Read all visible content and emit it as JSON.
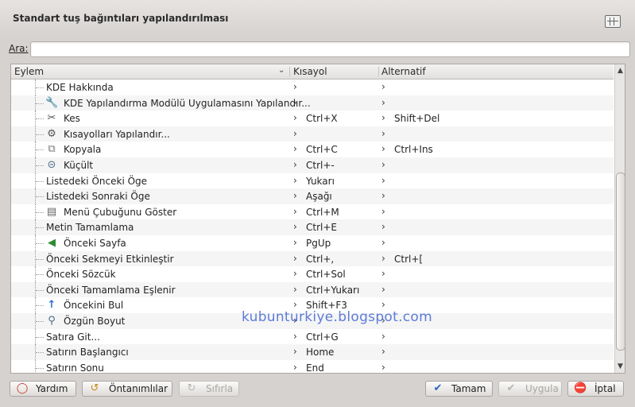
{
  "window": {
    "title": "Standart tuş bağıntıları yapılandırılması",
    "title_icon": "keyboard-grid-icon"
  },
  "search": {
    "label": "Ara:",
    "value": "",
    "placeholder": ""
  },
  "tree": {
    "columns": [
      "Eylem",
      "Kısayol",
      "Alternatif"
    ],
    "rows": [
      {
        "name": "KDE Hakkında",
        "icon": "",
        "shortcut": "",
        "alternate": ""
      },
      {
        "name": "KDE Yapılandırma Modülü Uygulamasını Yapılandır...",
        "icon": "wrench-icon",
        "shortcut": "",
        "alternate": ""
      },
      {
        "name": "Kes",
        "icon": "scissors-icon",
        "shortcut": "Ctrl+X",
        "alternate": "Shift+Del"
      },
      {
        "name": "Kısayolları Yapılandır...",
        "icon": "configure-shortcuts-icon",
        "shortcut": "",
        "alternate": ""
      },
      {
        "name": "Kopyala",
        "icon": "copy-icon",
        "shortcut": "Ctrl+C",
        "alternate": "Ctrl+Ins"
      },
      {
        "name": "Küçült",
        "icon": "zoom-out-icon",
        "shortcut": "Ctrl+-",
        "alternate": ""
      },
      {
        "name": "Listedeki Önceki Öge",
        "icon": "",
        "shortcut": "Yukarı",
        "alternate": ""
      },
      {
        "name": "Listedeki Sonraki Öge",
        "icon": "",
        "shortcut": "Aşağı",
        "alternate": ""
      },
      {
        "name": "Menü Çubuğunu Göster",
        "icon": "menubar-icon",
        "shortcut": "Ctrl+M",
        "alternate": ""
      },
      {
        "name": "Metin Tamamlama",
        "icon": "",
        "shortcut": "Ctrl+E",
        "alternate": ""
      },
      {
        "name": "Önceki Sayfa",
        "icon": "previous-page-icon",
        "shortcut": "PgUp",
        "alternate": ""
      },
      {
        "name": "Önceki Sekmeyi Etkinleştir",
        "icon": "",
        "shortcut": "Ctrl+,",
        "alternate": "Ctrl+["
      },
      {
        "name": "Önceki Sözcük",
        "icon": "",
        "shortcut": "Ctrl+Sol",
        "alternate": ""
      },
      {
        "name": "Önceki Tamamlama Eşlenir",
        "icon": "",
        "shortcut": "Ctrl+Yukarı",
        "alternate": ""
      },
      {
        "name": "Öncekini Bul",
        "icon": "up-arrow-icon",
        "shortcut": "Shift+F3",
        "alternate": ""
      },
      {
        "name": "Özgün Boyut",
        "icon": "zoom-original-icon",
        "shortcut": "",
        "alternate": ""
      },
      {
        "name": "Satıra Git...",
        "icon": "",
        "shortcut": "Ctrl+G",
        "alternate": ""
      },
      {
        "name": "Satırın Başlangıcı",
        "icon": "",
        "shortcut": "Home",
        "alternate": ""
      },
      {
        "name": "Satırın Sonu",
        "icon": "",
        "shortcut": "End",
        "alternate": ""
      }
    ]
  },
  "watermark": "kubunturkiye.blogspot.com",
  "buttons": {
    "help": {
      "label": "Yardım",
      "icon": "help-icon"
    },
    "defaults": {
      "label": "Öntanımlılar",
      "icon": "defaults-icon"
    },
    "reset": {
      "label": "Sıfırla",
      "icon": "reset-icon"
    },
    "ok": {
      "label": "Tamam",
      "icon": "checkmark-icon"
    },
    "apply": {
      "label": "Uygula",
      "icon": "checkmark-icon"
    },
    "cancel": {
      "label": "İptal",
      "icon": "cancel-icon"
    }
  },
  "colors": {
    "accent_blue": "#4d6fd6",
    "cancel_red": "#d22a2a",
    "ok_blue": "#2f64b8"
  }
}
